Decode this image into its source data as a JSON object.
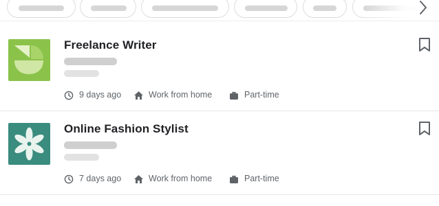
{
  "filter_bar": {
    "chips": [
      "",
      "",
      "",
      "",
      "",
      ""
    ],
    "more_icon": "chevron-right-icon"
  },
  "jobs": [
    {
      "title": "Freelance Writer",
      "logo_icon": "green-abstract-logo",
      "logo_color": "#8bc34a",
      "posted": "9 days ago",
      "location": "Work from home",
      "type": "Part-time",
      "bookmarked": false
    },
    {
      "title": "Online Fashion Stylist",
      "logo_icon": "teal-flower-logo",
      "logo_color": "#3a8c7e",
      "posted": "7 days ago",
      "location": "Work from home",
      "type": "Part-time",
      "bookmarked": false
    }
  ],
  "colors": {
    "text_primary": "#202124",
    "text_secondary": "#5f6368",
    "divider": "#e6e6e6"
  }
}
